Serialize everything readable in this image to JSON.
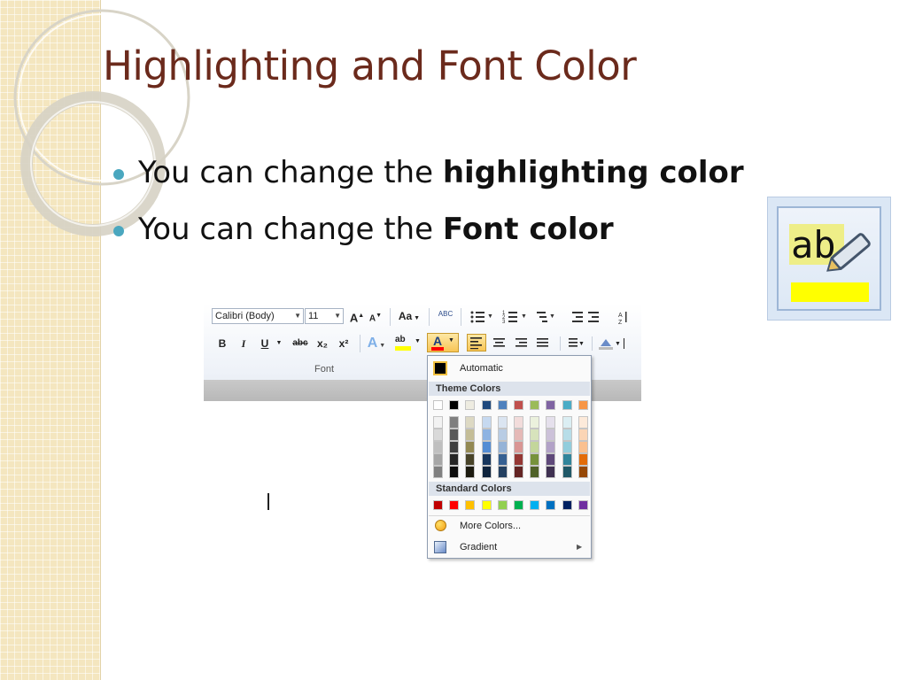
{
  "slide": {
    "title": "Highlighting and Font Color",
    "bullets": [
      {
        "prefix": "You can change the ",
        "bold": "highlighting color"
      },
      {
        "prefix": "You can change the ",
        "bold": "Font color"
      }
    ]
  },
  "highlighter_icon": {
    "text": "ab",
    "highlight_color": "#ffff00"
  },
  "ribbon": {
    "font_name": "Calibri (Body)",
    "font_size": "11",
    "change_case_label": "Aa",
    "spelling_label": "ABC",
    "bold_label": "B",
    "italic_label": "I",
    "underline_label": "U",
    "strike_label": "abc",
    "subscript_label": "x₂",
    "superscript_label": "x²",
    "highlight_label": "ab",
    "font_color_label": "A",
    "group_label": "Font"
  },
  "font_color_menu": {
    "automatic_label": "Automatic",
    "theme_colors_label": "Theme Colors",
    "standard_colors_label": "Standard Colors",
    "more_colors_label": "More Colors...",
    "gradient_label": "Gradient",
    "theme_colors": [
      "#ffffff",
      "#000000",
      "#eeece1",
      "#1f497d",
      "#4f81bd",
      "#c0504d",
      "#9bbb59",
      "#8064a2",
      "#4bacc6",
      "#f79646"
    ],
    "theme_shades": [
      [
        "#f2f2f2",
        "#d9d9d9",
        "#bfbfbf",
        "#a6a6a6",
        "#808080"
      ],
      [
        "#7f7f7f",
        "#595959",
        "#404040",
        "#262626",
        "#0d0d0d"
      ],
      [
        "#ddd9c3",
        "#c4bd97",
        "#938953",
        "#494429",
        "#1d1b10"
      ],
      [
        "#c6d9f0",
        "#8db3e2",
        "#548dd4",
        "#17365d",
        "#0f243e"
      ],
      [
        "#dbe5f1",
        "#b8cce4",
        "#95b3d7",
        "#366092",
        "#244061"
      ],
      [
        "#f2dcdb",
        "#e5b9b7",
        "#d99694",
        "#953734",
        "#632423"
      ],
      [
        "#ebf1dd",
        "#d7e3bc",
        "#c3d69b",
        "#76923c",
        "#4f6128"
      ],
      [
        "#e5e0ec",
        "#ccc1d9",
        "#b2a2c7",
        "#5f497a",
        "#3f3151"
      ],
      [
        "#dbeef3",
        "#b7dde8",
        "#92cddc",
        "#31859b",
        "#205867"
      ],
      [
        "#fdeada",
        "#fbd5b5",
        "#fac08f",
        "#e36c09",
        "#974806"
      ]
    ],
    "standard_colors": [
      "#c00000",
      "#ff0000",
      "#ffc000",
      "#ffff00",
      "#92d050",
      "#00b050",
      "#00b0f0",
      "#0070c0",
      "#002060",
      "#7030a0"
    ]
  },
  "colors": {
    "title": "#6b2a1c",
    "bullet": "#4aa7bf",
    "side_panel": "#f4e6bf"
  }
}
